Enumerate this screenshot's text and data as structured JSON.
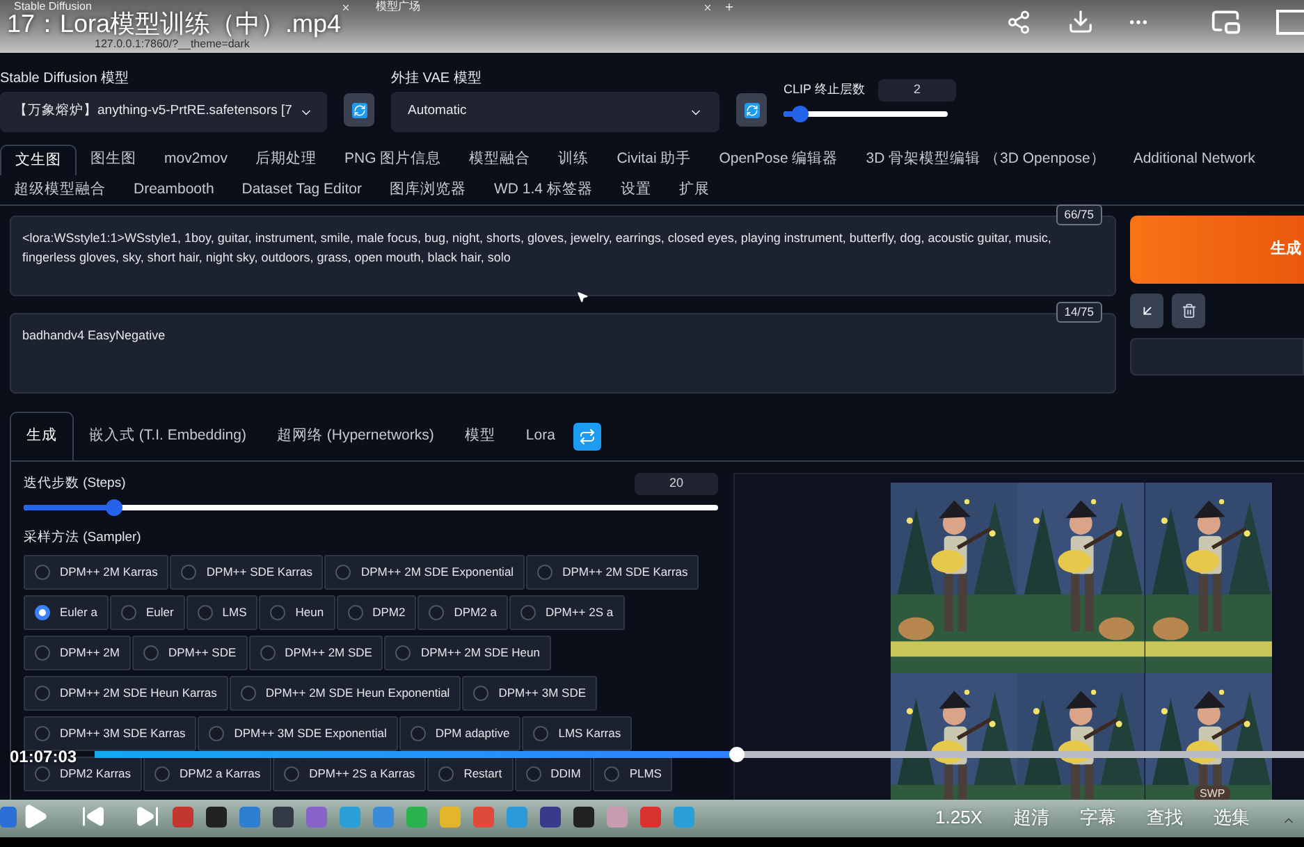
{
  "browser_tabs": [
    {
      "title": "Stable Diffusion"
    },
    {
      "title": "模型广场"
    }
  ],
  "video": {
    "title": "17：Lora模型训练（中）.mp4",
    "time": "01:07:03",
    "level": 0.53,
    "options": [
      "1.25X",
      "超清",
      "字幕",
      "查找",
      "选集"
    ],
    "badge": "SWP"
  },
  "address": "127.0.0.1:7860/?__theme=dark",
  "models": {
    "sd_label": "Stable Diffusion 模型",
    "sd_value": "【万象熔炉】anything-v5-PrtRE.safetensors [7",
    "vae_label": "外挂 VAE 模型",
    "vae_value": "Automatic"
  },
  "clip": {
    "label": "CLIP 终止层数",
    "value": "2",
    "level": 0.1
  },
  "main_tabs": [
    [
      {
        "label": "文生图",
        "selected": true
      },
      {
        "label": "图生图",
        "selected": false
      },
      {
        "label": "mov2mov",
        "selected": false
      },
      {
        "label": "后期处理",
        "selected": false
      },
      {
        "label": "PNG 图片信息",
        "selected": false
      },
      {
        "label": "模型融合",
        "selected": false
      },
      {
        "label": "训练",
        "selected": false
      },
      {
        "label": "Civitai 助手",
        "selected": false
      },
      {
        "label": "OpenPose 编辑器",
        "selected": false
      },
      {
        "label": "3D 骨架模型编辑 （3D Openpose）",
        "selected": false
      },
      {
        "label": "Additional Network",
        "selected": false
      }
    ],
    [
      {
        "label": "超级模型融合",
        "selected": false
      },
      {
        "label": "Dreambooth",
        "selected": false
      },
      {
        "label": "Dataset Tag Editor",
        "selected": false
      },
      {
        "label": "图库浏览器",
        "selected": false
      },
      {
        "label": "WD 1.4 标签器",
        "selected": false
      },
      {
        "label": "设置",
        "selected": false
      },
      {
        "label": "扩展",
        "selected": false
      }
    ]
  ],
  "prompt": {
    "text": "<lora:WSstyle1:1>WSstyle1, 1boy, guitar, instrument, smile, male focus, bug, night, shorts, gloves, jewelry, earrings, closed eyes, playing instrument, butterfly, dog, acoustic guitar, music, fingerless gloves, sky, short hair, night sky, outdoors, grass, open mouth, black hair, solo",
    "count": "66/75"
  },
  "negative_prompt": {
    "text": "badhandv4 EasyNegative",
    "count": "14/75"
  },
  "generate_button": "生成",
  "sub_tabs": [
    {
      "label": "生成",
      "selected": true
    },
    {
      "label": "嵌入式 (T.I. Embedding)",
      "selected": false
    },
    {
      "label": "超网络 (Hypernetworks)",
      "selected": false
    },
    {
      "label": "模型",
      "selected": false
    },
    {
      "label": "Lora",
      "selected": false
    }
  ],
  "steps": {
    "label": "迭代步数 (Steps)",
    "value": "20",
    "level": 0.13
  },
  "sampler": {
    "label": "采样方法 (Sampler)",
    "options": [
      {
        "label": "DPM++ 2M Karras",
        "selected": false
      },
      {
        "label": "DPM++ SDE Karras",
        "selected": false
      },
      {
        "label": "DPM++ 2M SDE Exponential",
        "selected": false
      },
      {
        "label": "DPM++ 2M SDE Karras",
        "selected": false
      },
      {
        "label": "Euler a",
        "selected": true
      },
      {
        "label": "Euler",
        "selected": false
      },
      {
        "label": "LMS",
        "selected": false
      },
      {
        "label": "Heun",
        "selected": false
      },
      {
        "label": "DPM2",
        "selected": false
      },
      {
        "label": "DPM2 a",
        "selected": false
      },
      {
        "label": "DPM++ 2S a",
        "selected": false
      },
      {
        "label": "DPM++ 2M",
        "selected": false
      },
      {
        "label": "DPM++ SDE",
        "selected": false
      },
      {
        "label": "DPM++ 2M SDE",
        "selected": false
      },
      {
        "label": "DPM++ 2M SDE Heun",
        "selected": false
      },
      {
        "label": "DPM++ 2M SDE Heun Karras",
        "selected": false
      },
      {
        "label": "DPM++ 2M SDE Heun Exponential",
        "selected": false
      },
      {
        "label": "DPM++ 3M SDE",
        "selected": false
      },
      {
        "label": "DPM++ 3M SDE Karras",
        "selected": false
      },
      {
        "label": "DPM++ 3M SDE Exponential",
        "selected": false
      },
      {
        "label": "DPM adaptive",
        "selected": false
      },
      {
        "label": "LMS Karras",
        "selected": false
      },
      {
        "label": "DPM2 Karras",
        "selected": false
      },
      {
        "label": "DPM2 a Karras",
        "selected": false
      },
      {
        "label": "DPM++ 2S a Karras",
        "selected": false
      },
      {
        "label": "Restart",
        "selected": false
      },
      {
        "label": "DDIM",
        "selected": false
      },
      {
        "label": "PLMS",
        "selected": false
      }
    ]
  }
}
